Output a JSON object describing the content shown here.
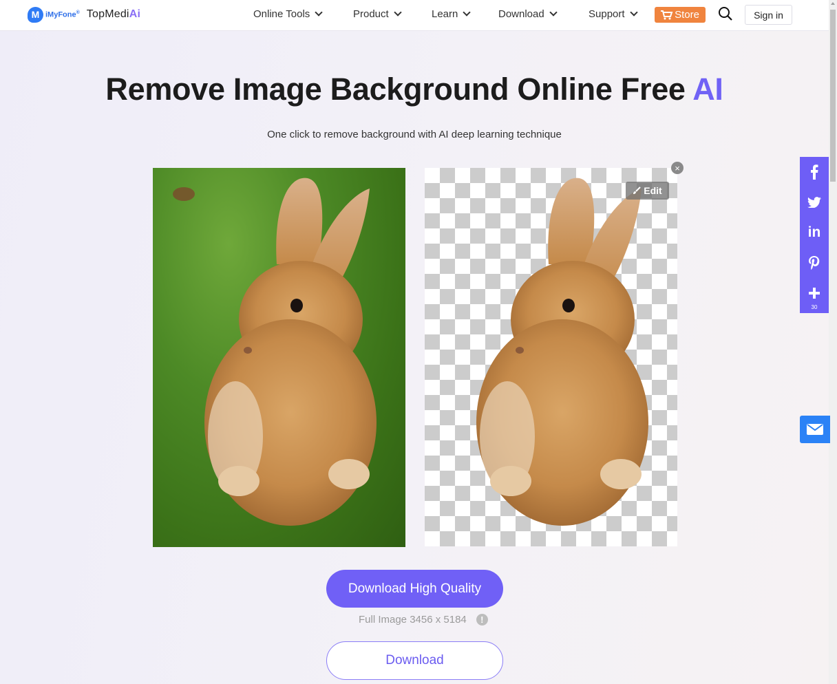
{
  "header": {
    "logo_company": "iMyFone",
    "logo_reg": "®",
    "logo_brand_main": "TopMedi",
    "logo_brand_ai": "Ai",
    "nav": [
      {
        "label": "Online Tools"
      },
      {
        "label": "Product"
      },
      {
        "label": "Learn"
      },
      {
        "label": "Download"
      },
      {
        "label": "Support"
      }
    ],
    "store_label": "Store",
    "signin_label": "Sign in"
  },
  "hero": {
    "title_main": "Remove Image Background Online Free ",
    "title_accent": "AI",
    "subtitle": "One click to remove background with AI deep learning technique"
  },
  "result": {
    "edit_label": "Edit",
    "close_symbol": "×"
  },
  "actions": {
    "download_hq_label": "Download High Quality",
    "full_image_info": "Full Image 3456 x 5184",
    "info_symbol": "!",
    "download_label": "Download"
  },
  "share": {
    "items": [
      "facebook",
      "twitter",
      "linkedin",
      "pinterest",
      "more"
    ],
    "count": "30"
  },
  "colors": {
    "accent": "#7060f6",
    "store": "#f0843e",
    "mail": "#2b82f6"
  }
}
